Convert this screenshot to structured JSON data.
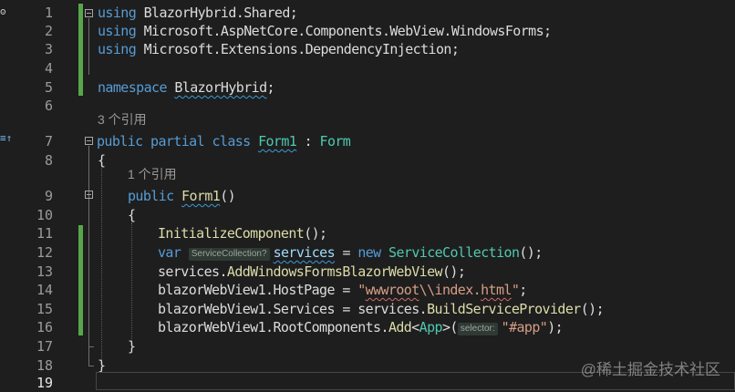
{
  "gutter_glyphs": {
    "top": "ʘ",
    "line7": "≡↑"
  },
  "line_numbers": [
    "1",
    "2",
    "3",
    "4",
    "5",
    "6",
    "7",
    "8",
    "9",
    "10",
    "11",
    "12",
    "13",
    "14",
    "15",
    "16",
    "17",
    "18",
    "19"
  ],
  "codelens": {
    "class_refs": "3 个引用",
    "ctor_refs": "1 个引用"
  },
  "code": {
    "l1": {
      "kw": "using",
      "ns": "BlazorHybrid.Shared",
      "end": ";"
    },
    "l2": {
      "kw": "using",
      "ns": "Microsoft.AspNetCore.Components.WebView.WindowsForms",
      "end": ";"
    },
    "l3": {
      "kw": "using",
      "ns": "Microsoft.Extensions.DependencyInjection",
      "end": ";"
    },
    "l5": {
      "kw": "namespace",
      "ns": "BlazorHybrid",
      "end": ";"
    },
    "l7": {
      "kw": "public partial class",
      "name": "Form1",
      "sep": " : ",
      "base": "Form"
    },
    "l8": {
      "text": "{"
    },
    "l9": {
      "kw": "public",
      "name": "Form1",
      "rest": "()"
    },
    "l10": {
      "text": "{"
    },
    "l11": {
      "fn": "InitializeComponent",
      "rest": "();"
    },
    "l12": {
      "kw": "var",
      "hint": "ServiceCollection?",
      "var": "services",
      "op": " = ",
      "kw2": "new",
      "type": "ServiceCollection",
      "rest": "();"
    },
    "l13": {
      "obj": "services.",
      "fn": "AddWindowsFormsBlazorWebView",
      "rest": "();"
    },
    "l14": {
      "obj": "blazorWebView1.HostPage = ",
      "str_a": "\"",
      "str_b": "wwwroot",
      "str_c": "\\\\index",
      "str_d": ".",
      "str_e": "html",
      "str_f": "\"",
      "end": ";"
    },
    "l15": {
      "obj": "blazorWebView1.Services = services.",
      "fn": "BuildServiceProvider",
      "rest": "();"
    },
    "l16": {
      "obj": "blazorWebView1.RootComponents.",
      "fn": "Add",
      "lt": "<",
      "type": "App",
      "gt": ">(",
      "hint": "selector:",
      "str": "\"#app\"",
      "end": ");"
    },
    "l17": {
      "text": "}"
    },
    "l18": {
      "text": "}"
    }
  },
  "watermark": "@稀土掘金技术社区"
}
